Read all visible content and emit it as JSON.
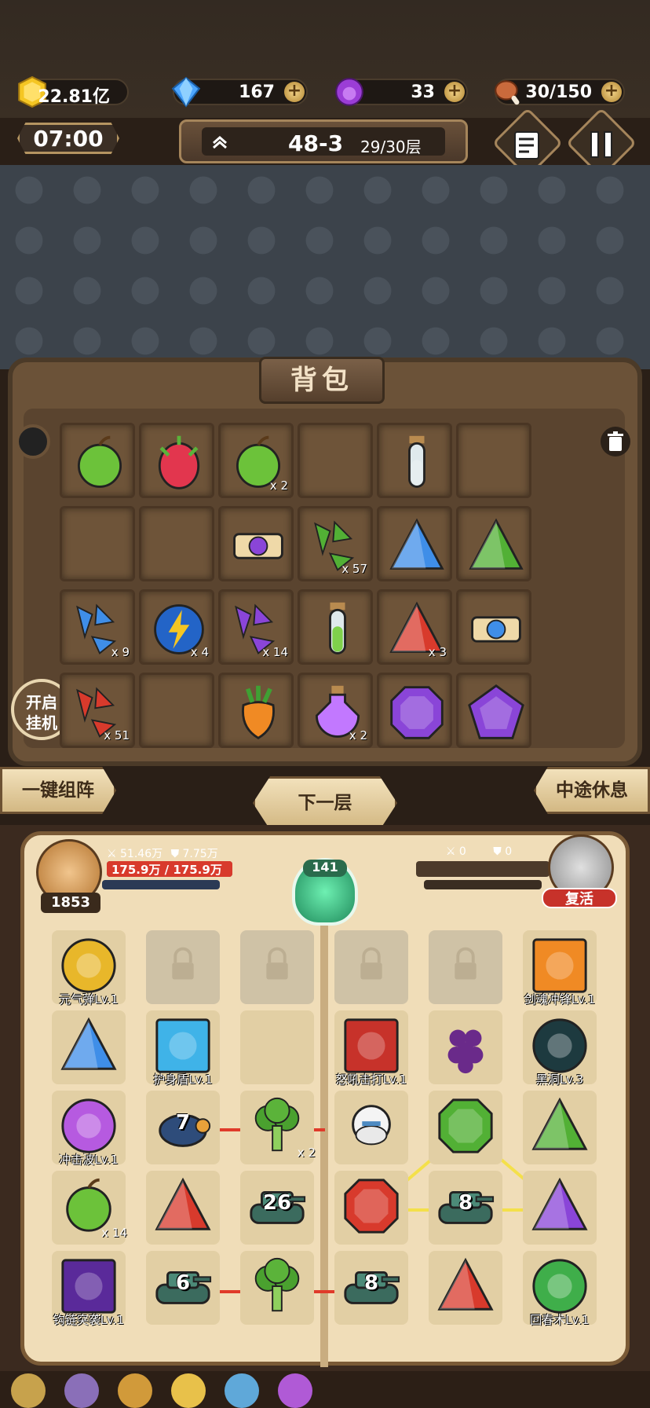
{
  "resources": {
    "gold": "22.81亿",
    "diamond": "167",
    "orb": "33",
    "stamina": "30/150"
  },
  "timer": "07:00",
  "stage": {
    "level": "48-3",
    "floor": "29/30层"
  },
  "bag": {
    "title": "背包",
    "auto_label_1": "开启",
    "auto_label_2": "挂机",
    "items": [
      {
        "icon": "green-fruit-icon",
        "count": ""
      },
      {
        "icon": "dragonfruit-icon",
        "count": ""
      },
      {
        "icon": "green-apple-icon",
        "count": "x 2"
      },
      {
        "icon": "empty",
        "count": ""
      },
      {
        "icon": "empty-vial-icon",
        "count": ""
      },
      {
        "icon": "empty",
        "count": ""
      },
      {
        "icon": "empty",
        "count": ""
      },
      {
        "icon": "empty",
        "count": ""
      },
      {
        "icon": "purple-scroll-icon",
        "count": ""
      },
      {
        "icon": "green-shards-icon",
        "count": "x 57"
      },
      {
        "icon": "blue-pyramid-icon",
        "count": ""
      },
      {
        "icon": "green-pyramid-icon",
        "count": ""
      },
      {
        "icon": "blue-shards-icon",
        "count": "x 9"
      },
      {
        "icon": "lightning-orb-icon",
        "count": "x 4"
      },
      {
        "icon": "purple-shards-icon",
        "count": "x 14"
      },
      {
        "icon": "green-vial-icon",
        "count": ""
      },
      {
        "icon": "red-pyramid-icon",
        "count": "x 3"
      },
      {
        "icon": "blue-scroll-icon",
        "count": ""
      },
      {
        "icon": "red-shards-icon",
        "count": "x 51"
      },
      {
        "icon": "empty",
        "count": ""
      },
      {
        "icon": "carrot-icon",
        "count": ""
      },
      {
        "icon": "purple-potion-icon",
        "count": "x 2"
      },
      {
        "icon": "purple-hexagon-gem-icon",
        "count": ""
      },
      {
        "icon": "purple-pentagon-gem-icon",
        "count": ""
      }
    ]
  },
  "actions": {
    "auto_form": "一键组阵",
    "next_floor": "下一层",
    "rest": "中途休息"
  },
  "player": {
    "attack": "51.46万",
    "defense": "7.75万",
    "hp": "175.9万 / 175.9万",
    "power": "1853",
    "hp_fraction": 1.0
  },
  "enemy": {
    "attack": "0",
    "defense": "0",
    "revive": "复活"
  },
  "center_badge": "141",
  "left_grid": [
    {
      "icon": "gold-orb-icon",
      "caption": "元气弹Lv.1",
      "count": ""
    },
    {
      "icon": "lock-icon",
      "caption": "",
      "count": "",
      "locked": true
    },
    {
      "icon": "lock-icon",
      "caption": "",
      "count": "",
      "locked": true
    },
    {
      "icon": "blue-pyramid-icon",
      "caption": "",
      "count": ""
    },
    {
      "icon": "shield-skill-icon",
      "caption": "护身盾Lv.1",
      "count": ""
    },
    {
      "icon": "empty",
      "caption": "",
      "count": ""
    },
    {
      "icon": "purple-wave-icon",
      "caption": "冲击波Lv.1",
      "count": ""
    },
    {
      "icon": "turtle-icon",
      "caption": "",
      "count": "",
      "level": "7"
    },
    {
      "icon": "broccoli-icon",
      "caption": "",
      "count": "x 2"
    },
    {
      "icon": "green-pepper-icon",
      "caption": "",
      "count": "x 14"
    },
    {
      "icon": "red-pyramid-icon",
      "caption": "",
      "count": ""
    },
    {
      "icon": "tank-icon",
      "caption": "",
      "count": "",
      "level": "26"
    },
    {
      "icon": "chain-skill-icon",
      "caption": "钩链突袭Lv.1",
      "count": ""
    },
    {
      "icon": "tank-icon",
      "caption": "",
      "count": "",
      "level": "6"
    },
    {
      "icon": "broccoli-icon",
      "caption": "",
      "count": ""
    }
  ],
  "right_grid": [
    {
      "icon": "lock-icon",
      "caption": "",
      "count": "",
      "locked": true
    },
    {
      "icon": "lock-icon",
      "caption": "",
      "count": "",
      "locked": true
    },
    {
      "icon": "sword-soul-icon",
      "caption": "剑魂冲锋Lv.1",
      "count": ""
    },
    {
      "icon": "roar-skill-icon",
      "caption": "怒吼击打Lv.1",
      "count": ""
    },
    {
      "icon": "grapes-icon",
      "caption": "",
      "count": ""
    },
    {
      "icon": "black-hole-icon",
      "caption": "黑洞Lv.3",
      "count": ""
    },
    {
      "icon": "old-man-icon",
      "caption": "",
      "count": ""
    },
    {
      "icon": "green-octagon-gem-icon",
      "caption": "",
      "count": ""
    },
    {
      "icon": "green-pyramid-icon",
      "caption": "",
      "count": ""
    },
    {
      "icon": "red-octagon-gem-icon",
      "caption": "",
      "count": ""
    },
    {
      "icon": "tank-icon",
      "caption": "",
      "count": "",
      "level": "8"
    },
    {
      "icon": "purple-pyramid-icon",
      "caption": "",
      "count": ""
    },
    {
      "icon": "tank-icon",
      "caption": "",
      "count": "",
      "level": "8"
    },
    {
      "icon": "red-pyramid-icon",
      "caption": "",
      "count": ""
    },
    {
      "icon": "heart-skill-icon",
      "caption": "回春术Lv.1",
      "count": ""
    }
  ],
  "colors": {
    "gold": "#f5c623",
    "diamond": "#4da6ff",
    "orb": "#9b3dd6",
    "hp_red": "#d83a2c",
    "link_yellow": "#f4e04a",
    "link_red": "#e03a2a"
  }
}
